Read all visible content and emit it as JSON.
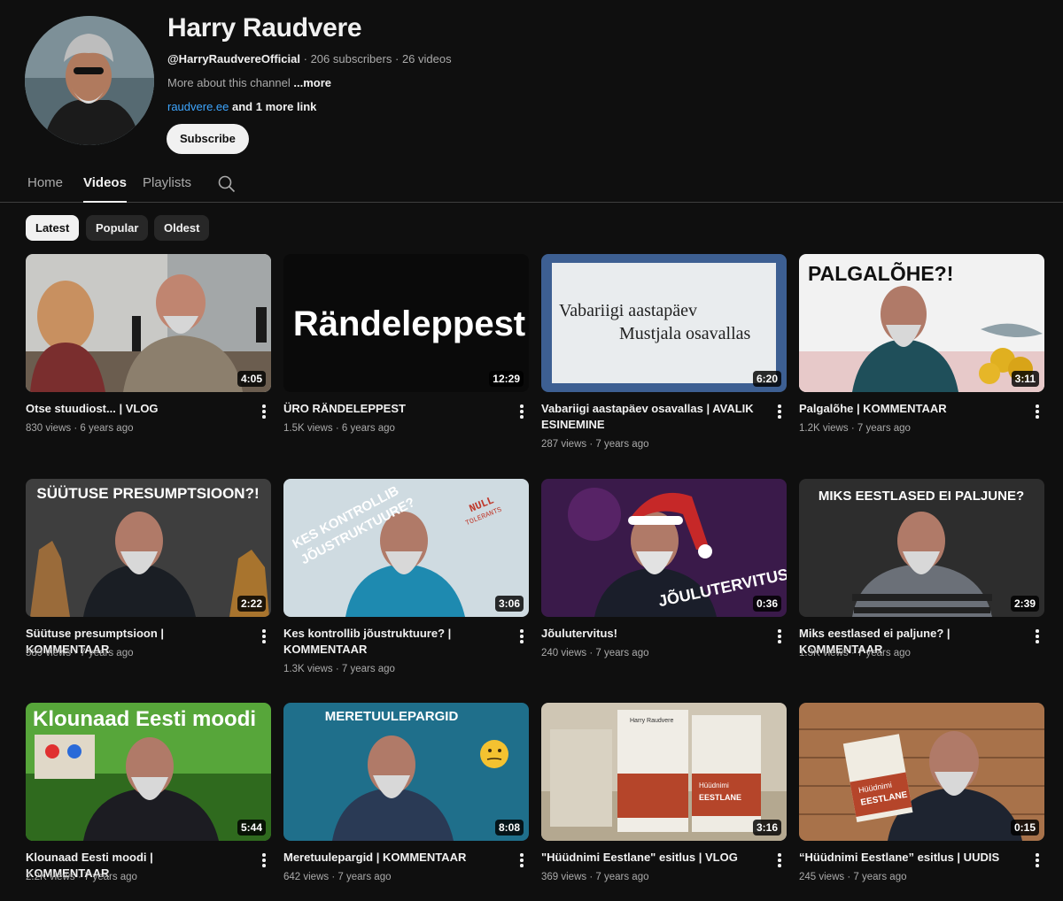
{
  "channel": {
    "name": "Harry Raudvere",
    "handle": "@HarryRaudvereOfficial",
    "subscribers": "206 subscribers",
    "video_count": "26 videos",
    "separator": "·",
    "about": "More about this channel",
    "about_more": "...more",
    "link": "raudvere.ee",
    "link_more": "and 1 more link",
    "subscribe_label": "Subscribe"
  },
  "tabs": [
    {
      "label": "Home"
    },
    {
      "label": "Videos"
    },
    {
      "label": "Playlists"
    }
  ],
  "active_tab": "Videos",
  "filters": [
    {
      "label": "Latest"
    },
    {
      "label": "Popular"
    },
    {
      "label": "Oldest"
    }
  ],
  "active_filter": "Latest",
  "videos": [
    {
      "title": "Otse stuudiost... | VLOG",
      "views": "830 views",
      "age": "6 years ago",
      "duration": "4:05",
      "thumb_text": ""
    },
    {
      "title": "ÜRO RÄNDELEPPEST",
      "views": "1.5K views",
      "age": "6 years ago",
      "duration": "12:29",
      "thumb_text": "Rändeleppest"
    },
    {
      "title": "Vabariigi aastapäev osavallas | AVALIK ESINEMINE",
      "views": "287 views",
      "age": "7 years ago",
      "duration": "6:20",
      "thumb_text": "Vabariigi aastapäev",
      "thumb_text_2": "Mustjala osavallas"
    },
    {
      "title": "Palgalõhe | KOMMENTAAR",
      "views": "1.2K views",
      "age": "7 years ago",
      "duration": "3:11",
      "thumb_text": "PALGALÕHE?!"
    },
    {
      "title": "Süütuse presumptsioon | KOMMENTAAR",
      "views": "589 views",
      "age": "7 years ago",
      "duration": "2:22",
      "thumb_text": "SÜÜTUSE PRESUMPTSIOON?!"
    },
    {
      "title": "Kes kontrollib jõustruktuure? | KOMMENTAAR",
      "views": "1.3K views",
      "age": "7 years ago",
      "duration": "3:06",
      "thumb_text": "KES KONTROLLIB",
      "thumb_text_2": "JÕUSTRUKTUURE?",
      "thumb_text_3": "NULL",
      "thumb_text_4": "TOLERANTS"
    },
    {
      "title": "Jõulutervitus!",
      "views": "240 views",
      "age": "7 years ago",
      "duration": "0:36",
      "thumb_text": "JÕULUTERVITUS"
    },
    {
      "title": "Miks eestlased ei paljune? | KOMMENTAAR",
      "views": "1.3K views",
      "age": "7 years ago",
      "duration": "2:39",
      "thumb_text": "MIKS EESTLASED EI PALJUNE?"
    },
    {
      "title": "Klounaad Eesti moodi | KOMMENTAAR",
      "views": "2.2K views",
      "age": "7 years ago",
      "duration": "5:44",
      "thumb_text": "Klounaad Eesti moodi"
    },
    {
      "title": "Meretuulepargid | KOMMENTAAR",
      "views": "642 views",
      "age": "7 years ago",
      "duration": "8:08",
      "thumb_text": "MERETUULEPARGID"
    },
    {
      "title": "\"Hüüdnimi Eestlane\" esitlus | VLOG",
      "views": "369 views",
      "age": "7 years ago",
      "duration": "3:16",
      "thumb_text": "Harry Raudvere",
      "thumb_text_2": "Hüüdnimi",
      "thumb_text_3": "EESTLANE"
    },
    {
      "title": "“Hüüdnimi Eestlane” esitlus | UUDIS",
      "views": "245 views",
      "age": "7 years ago",
      "duration": "0:15",
      "thumb_text": "Hüüdnimi",
      "thumb_text_2": "EESTLANE"
    }
  ],
  "colors": {
    "background": "#0f0f0f",
    "text_primary": "#f1f1f1",
    "text_secondary": "#aaaaaa",
    "link": "#3ea6ff",
    "chip_bg": "#272727"
  }
}
